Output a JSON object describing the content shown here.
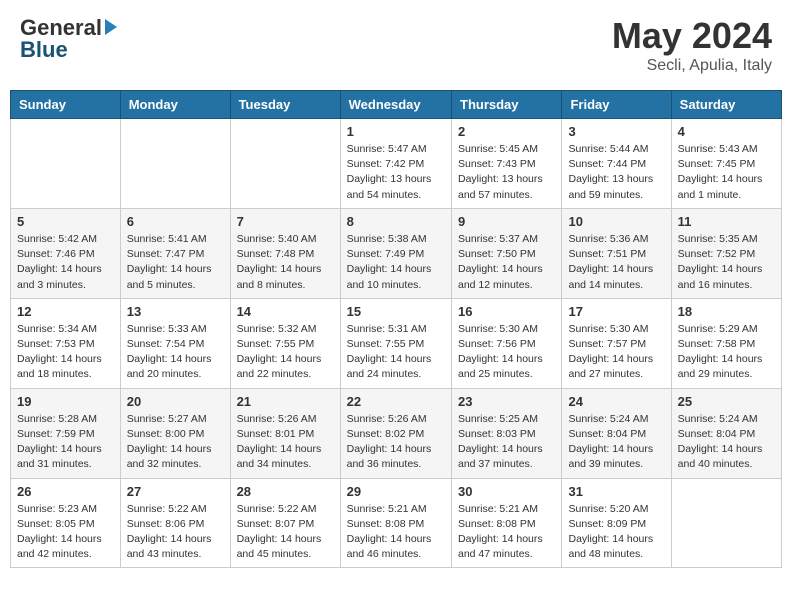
{
  "header": {
    "logo_general": "General",
    "logo_blue": "Blue",
    "title": "May 2024",
    "location": "Secli, Apulia, Italy"
  },
  "days_of_week": [
    "Sunday",
    "Monday",
    "Tuesday",
    "Wednesday",
    "Thursday",
    "Friday",
    "Saturday"
  ],
  "weeks": [
    [
      {
        "day": "",
        "info": ""
      },
      {
        "day": "",
        "info": ""
      },
      {
        "day": "",
        "info": ""
      },
      {
        "day": "1",
        "info": "Sunrise: 5:47 AM\nSunset: 7:42 PM\nDaylight: 13 hours\nand 54 minutes."
      },
      {
        "day": "2",
        "info": "Sunrise: 5:45 AM\nSunset: 7:43 PM\nDaylight: 13 hours\nand 57 minutes."
      },
      {
        "day": "3",
        "info": "Sunrise: 5:44 AM\nSunset: 7:44 PM\nDaylight: 13 hours\nand 59 minutes."
      },
      {
        "day": "4",
        "info": "Sunrise: 5:43 AM\nSunset: 7:45 PM\nDaylight: 14 hours\nand 1 minute."
      }
    ],
    [
      {
        "day": "5",
        "info": "Sunrise: 5:42 AM\nSunset: 7:46 PM\nDaylight: 14 hours\nand 3 minutes."
      },
      {
        "day": "6",
        "info": "Sunrise: 5:41 AM\nSunset: 7:47 PM\nDaylight: 14 hours\nand 5 minutes."
      },
      {
        "day": "7",
        "info": "Sunrise: 5:40 AM\nSunset: 7:48 PM\nDaylight: 14 hours\nand 8 minutes."
      },
      {
        "day": "8",
        "info": "Sunrise: 5:38 AM\nSunset: 7:49 PM\nDaylight: 14 hours\nand 10 minutes."
      },
      {
        "day": "9",
        "info": "Sunrise: 5:37 AM\nSunset: 7:50 PM\nDaylight: 14 hours\nand 12 minutes."
      },
      {
        "day": "10",
        "info": "Sunrise: 5:36 AM\nSunset: 7:51 PM\nDaylight: 14 hours\nand 14 minutes."
      },
      {
        "day": "11",
        "info": "Sunrise: 5:35 AM\nSunset: 7:52 PM\nDaylight: 14 hours\nand 16 minutes."
      }
    ],
    [
      {
        "day": "12",
        "info": "Sunrise: 5:34 AM\nSunset: 7:53 PM\nDaylight: 14 hours\nand 18 minutes."
      },
      {
        "day": "13",
        "info": "Sunrise: 5:33 AM\nSunset: 7:54 PM\nDaylight: 14 hours\nand 20 minutes."
      },
      {
        "day": "14",
        "info": "Sunrise: 5:32 AM\nSunset: 7:55 PM\nDaylight: 14 hours\nand 22 minutes."
      },
      {
        "day": "15",
        "info": "Sunrise: 5:31 AM\nSunset: 7:55 PM\nDaylight: 14 hours\nand 24 minutes."
      },
      {
        "day": "16",
        "info": "Sunrise: 5:30 AM\nSunset: 7:56 PM\nDaylight: 14 hours\nand 25 minutes."
      },
      {
        "day": "17",
        "info": "Sunrise: 5:30 AM\nSunset: 7:57 PM\nDaylight: 14 hours\nand 27 minutes."
      },
      {
        "day": "18",
        "info": "Sunrise: 5:29 AM\nSunset: 7:58 PM\nDaylight: 14 hours\nand 29 minutes."
      }
    ],
    [
      {
        "day": "19",
        "info": "Sunrise: 5:28 AM\nSunset: 7:59 PM\nDaylight: 14 hours\nand 31 minutes."
      },
      {
        "day": "20",
        "info": "Sunrise: 5:27 AM\nSunset: 8:00 PM\nDaylight: 14 hours\nand 32 minutes."
      },
      {
        "day": "21",
        "info": "Sunrise: 5:26 AM\nSunset: 8:01 PM\nDaylight: 14 hours\nand 34 minutes."
      },
      {
        "day": "22",
        "info": "Sunrise: 5:26 AM\nSunset: 8:02 PM\nDaylight: 14 hours\nand 36 minutes."
      },
      {
        "day": "23",
        "info": "Sunrise: 5:25 AM\nSunset: 8:03 PM\nDaylight: 14 hours\nand 37 minutes."
      },
      {
        "day": "24",
        "info": "Sunrise: 5:24 AM\nSunset: 8:04 PM\nDaylight: 14 hours\nand 39 minutes."
      },
      {
        "day": "25",
        "info": "Sunrise: 5:24 AM\nSunset: 8:04 PM\nDaylight: 14 hours\nand 40 minutes."
      }
    ],
    [
      {
        "day": "26",
        "info": "Sunrise: 5:23 AM\nSunset: 8:05 PM\nDaylight: 14 hours\nand 42 minutes."
      },
      {
        "day": "27",
        "info": "Sunrise: 5:22 AM\nSunset: 8:06 PM\nDaylight: 14 hours\nand 43 minutes."
      },
      {
        "day": "28",
        "info": "Sunrise: 5:22 AM\nSunset: 8:07 PM\nDaylight: 14 hours\nand 45 minutes."
      },
      {
        "day": "29",
        "info": "Sunrise: 5:21 AM\nSunset: 8:08 PM\nDaylight: 14 hours\nand 46 minutes."
      },
      {
        "day": "30",
        "info": "Sunrise: 5:21 AM\nSunset: 8:08 PM\nDaylight: 14 hours\nand 47 minutes."
      },
      {
        "day": "31",
        "info": "Sunrise: 5:20 AM\nSunset: 8:09 PM\nDaylight: 14 hours\nand 48 minutes."
      },
      {
        "day": "",
        "info": ""
      }
    ]
  ]
}
